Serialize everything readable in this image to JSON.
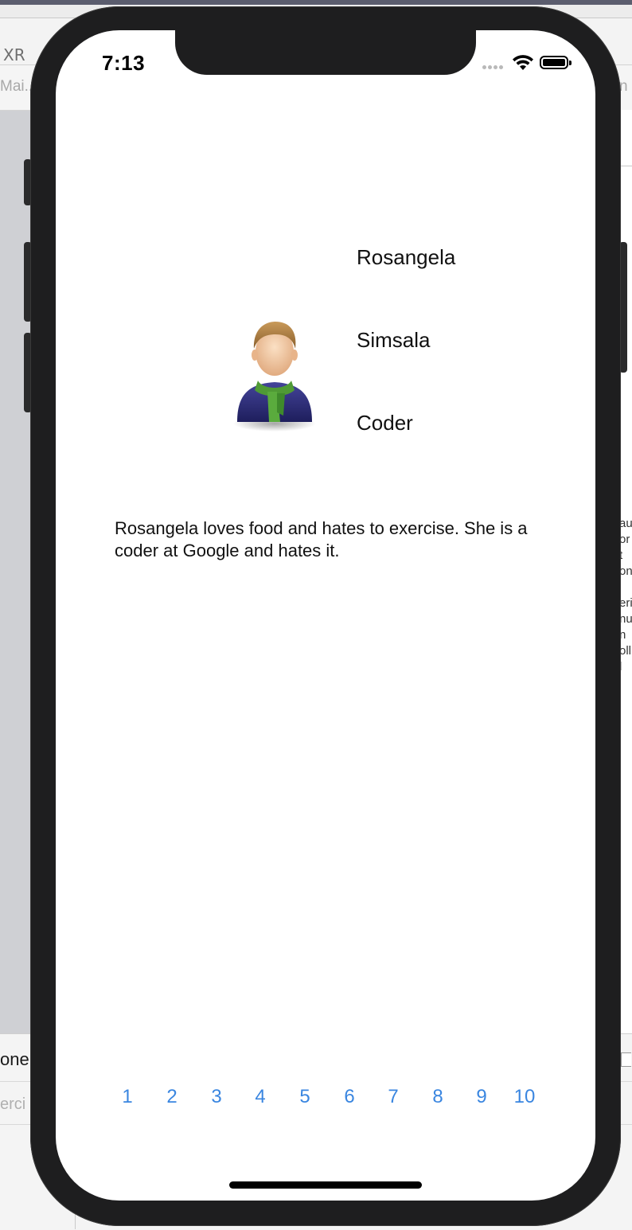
{
  "host": {
    "device_label": "XR",
    "tab_left": "Mai..",
    "tab_right": "n",
    "lower_text_1": "one",
    "lower_text_2": "erci",
    "right_panel_lines": [
      "au",
      "or",
      "t",
      "on",
      "",
      "eri",
      "nu",
      "n",
      "olli",
      "l"
    ]
  },
  "status_bar": {
    "time": "7:13"
  },
  "profile": {
    "first_name": "Rosangela",
    "last_name": "Simsala",
    "job_title": "Coder",
    "bio": "Rosangela loves food and hates to exercise. She is a coder at Google and hates it."
  },
  "pager": {
    "pages": [
      "1",
      "2",
      "3",
      "4",
      "5",
      "6",
      "7",
      "8",
      "9",
      "10"
    ],
    "color": "#3a86e0"
  },
  "icons": {
    "avatar": "person-with-scarf-icon",
    "wifi": "wifi-icon",
    "battery": "battery-full-icon",
    "signal": "cellular-signal-icon"
  }
}
